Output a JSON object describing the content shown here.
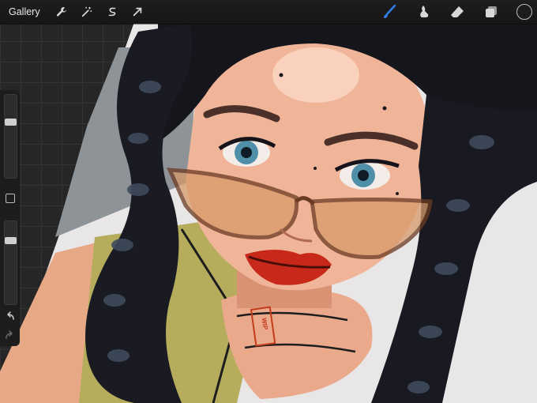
{
  "topbar": {
    "gallery_label": "Gallery",
    "left_tools": [
      "wrench-icon",
      "magic-wand-icon",
      "selection-icon",
      "transform-arrow-icon"
    ],
    "right_tools": [
      "brush-icon",
      "smudge-icon",
      "eraser-icon",
      "layers-icon"
    ],
    "active_tool": "brush-icon",
    "active_color": "#1c1c1c",
    "accent_color": "#2f7fe6"
  },
  "sidebar": {
    "brush_size": 0.28,
    "opacity": 0.24,
    "undo_icon": "undo-icon",
    "redo_icon": "redo-icon"
  },
  "artwork": {
    "stamp_text": "WIP"
  }
}
